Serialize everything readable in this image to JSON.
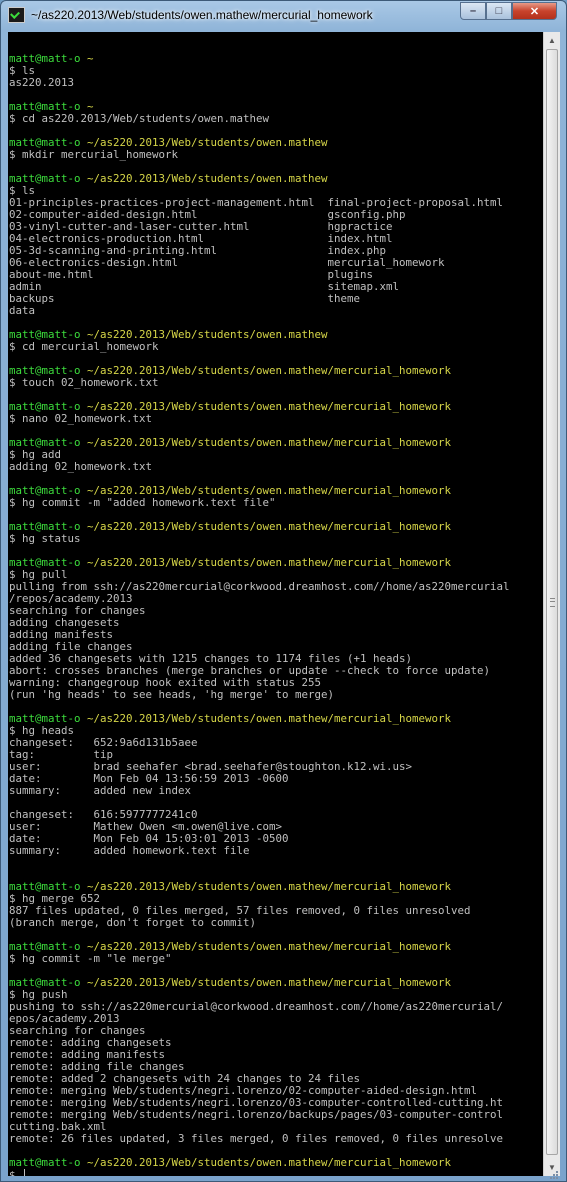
{
  "window": {
    "title": "~/as220.2013/Web/students/owen.mathew/mercurial_homework",
    "minimize_glyph": "–",
    "maximize_glyph": "□",
    "close_glyph": "✕"
  },
  "scrollbar": {
    "up_glyph": "▲",
    "down_glyph": "▼"
  },
  "terminal": {
    "lines": [
      {
        "t": "blank"
      },
      {
        "t": "prompt",
        "user": "matt@matt-o",
        "path": "~"
      },
      {
        "t": "out",
        "text": "$ ls"
      },
      {
        "t": "out",
        "text": "as220.2013"
      },
      {
        "t": "blank"
      },
      {
        "t": "prompt",
        "user": "matt@matt-o",
        "path": "~"
      },
      {
        "t": "out",
        "text": "$ cd as220.2013/Web/students/owen.mathew"
      },
      {
        "t": "blank"
      },
      {
        "t": "prompt",
        "user": "matt@matt-o",
        "path": "~/as220.2013/Web/students/owen.mathew"
      },
      {
        "t": "out",
        "text": "$ mkdir mercurial_homework"
      },
      {
        "t": "blank"
      },
      {
        "t": "prompt",
        "user": "matt@matt-o",
        "path": "~/as220.2013/Web/students/owen.mathew"
      },
      {
        "t": "out",
        "text": "$ ls"
      },
      {
        "t": "out",
        "text": "01-principles-practices-project-management.html  final-project-proposal.html"
      },
      {
        "t": "out",
        "text": "02-computer-aided-design.html                    gsconfig.php"
      },
      {
        "t": "out",
        "text": "03-vinyl-cutter-and-laser-cutter.html            hgpractice"
      },
      {
        "t": "out",
        "text": "04-electronics-production.html                   index.html"
      },
      {
        "t": "out",
        "text": "05-3d-scanning-and-printing.html                 index.php"
      },
      {
        "t": "out",
        "text": "06-electronics-design.html                       mercurial_homework"
      },
      {
        "t": "out",
        "text": "about-me.html                                    plugins"
      },
      {
        "t": "out",
        "text": "admin                                            sitemap.xml"
      },
      {
        "t": "out",
        "text": "backups                                          theme"
      },
      {
        "t": "out",
        "text": "data"
      },
      {
        "t": "blank"
      },
      {
        "t": "prompt",
        "user": "matt@matt-o",
        "path": "~/as220.2013/Web/students/owen.mathew"
      },
      {
        "t": "out",
        "text": "$ cd mercurial_homework"
      },
      {
        "t": "blank"
      },
      {
        "t": "prompt",
        "user": "matt@matt-o",
        "path": "~/as220.2013/Web/students/owen.mathew/mercurial_homework"
      },
      {
        "t": "out",
        "text": "$ touch 02_homework.txt"
      },
      {
        "t": "blank"
      },
      {
        "t": "prompt",
        "user": "matt@matt-o",
        "path": "~/as220.2013/Web/students/owen.mathew/mercurial_homework"
      },
      {
        "t": "out",
        "text": "$ nano 02_homework.txt"
      },
      {
        "t": "blank"
      },
      {
        "t": "prompt",
        "user": "matt@matt-o",
        "path": "~/as220.2013/Web/students/owen.mathew/mercurial_homework"
      },
      {
        "t": "out",
        "text": "$ hg add"
      },
      {
        "t": "out",
        "text": "adding 02_homework.txt"
      },
      {
        "t": "blank"
      },
      {
        "t": "prompt",
        "user": "matt@matt-o",
        "path": "~/as220.2013/Web/students/owen.mathew/mercurial_homework"
      },
      {
        "t": "out",
        "text": "$ hg commit -m \"added homework.text file\""
      },
      {
        "t": "blank"
      },
      {
        "t": "prompt",
        "user": "matt@matt-o",
        "path": "~/as220.2013/Web/students/owen.mathew/mercurial_homework"
      },
      {
        "t": "out",
        "text": "$ hg status"
      },
      {
        "t": "blank"
      },
      {
        "t": "prompt",
        "user": "matt@matt-o",
        "path": "~/as220.2013/Web/students/owen.mathew/mercurial_homework"
      },
      {
        "t": "out",
        "text": "$ hg pull"
      },
      {
        "t": "out",
        "text": "pulling from ssh://as220mercurial@corkwood.dreamhost.com//home/as220mercurial"
      },
      {
        "t": "out",
        "text": "/repos/academy.2013"
      },
      {
        "t": "out",
        "text": "searching for changes"
      },
      {
        "t": "out",
        "text": "adding changesets"
      },
      {
        "t": "out",
        "text": "adding manifests"
      },
      {
        "t": "out",
        "text": "adding file changes"
      },
      {
        "t": "out",
        "text": "added 36 changesets with 1215 changes to 1174 files (+1 heads)"
      },
      {
        "t": "out",
        "text": "abort: crosses branches (merge branches or update --check to force update)"
      },
      {
        "t": "out",
        "text": "warning: changegroup hook exited with status 255"
      },
      {
        "t": "out",
        "text": "(run 'hg heads' to see heads, 'hg merge' to merge)"
      },
      {
        "t": "blank"
      },
      {
        "t": "prompt",
        "user": "matt@matt-o",
        "path": "~/as220.2013/Web/students/owen.mathew/mercurial_homework"
      },
      {
        "t": "out",
        "text": "$ hg heads"
      },
      {
        "t": "out",
        "text": "changeset:   652:9a6d131b5aee"
      },
      {
        "t": "out",
        "text": "tag:         tip"
      },
      {
        "t": "out",
        "text": "user:        brad seehafer <brad.seehafer@stoughton.k12.wi.us>"
      },
      {
        "t": "out",
        "text": "date:        Mon Feb 04 13:56:59 2013 -0600"
      },
      {
        "t": "out",
        "text": "summary:     added new index"
      },
      {
        "t": "blank"
      },
      {
        "t": "out",
        "text": "changeset:   616:5977777241c0"
      },
      {
        "t": "out",
        "text": "user:        Mathew Owen <m.owen@live.com>"
      },
      {
        "t": "out",
        "text": "date:        Mon Feb 04 15:03:01 2013 -0500"
      },
      {
        "t": "out",
        "text": "summary:     added homework.text file"
      },
      {
        "t": "blank"
      },
      {
        "t": "blank"
      },
      {
        "t": "prompt",
        "user": "matt@matt-o",
        "path": "~/as220.2013/Web/students/owen.mathew/mercurial_homework"
      },
      {
        "t": "out",
        "text": "$ hg merge 652"
      },
      {
        "t": "out",
        "text": "887 files updated, 0 files merged, 57 files removed, 0 files unresolved"
      },
      {
        "t": "out",
        "text": "(branch merge, don't forget to commit)"
      },
      {
        "t": "blank"
      },
      {
        "t": "prompt",
        "user": "matt@matt-o",
        "path": "~/as220.2013/Web/students/owen.mathew/mercurial_homework"
      },
      {
        "t": "out",
        "text": "$ hg commit -m \"le merge\""
      },
      {
        "t": "blank"
      },
      {
        "t": "prompt",
        "user": "matt@matt-o",
        "path": "~/as220.2013/Web/students/owen.mathew/mercurial_homework"
      },
      {
        "t": "out",
        "text": "$ hg push"
      },
      {
        "t": "out",
        "text": "pushing to ssh://as220mercurial@corkwood.dreamhost.com//home/as220mercurial/"
      },
      {
        "t": "out",
        "text": "epos/academy.2013"
      },
      {
        "t": "out",
        "text": "searching for changes"
      },
      {
        "t": "out",
        "text": "remote: adding changesets"
      },
      {
        "t": "out",
        "text": "remote: adding manifests"
      },
      {
        "t": "out",
        "text": "remote: adding file changes"
      },
      {
        "t": "out",
        "text": "remote: added 2 changesets with 24 changes to 24 files"
      },
      {
        "t": "out",
        "text": "remote: merging Web/students/negri.lorenzo/02-computer-aided-design.html"
      },
      {
        "t": "out",
        "text": "remote: merging Web/students/negri.lorenzo/03-computer-controlled-cutting.ht"
      },
      {
        "t": "out",
        "text": "remote: merging Web/students/negri.lorenzo/backups/pages/03-computer-control"
      },
      {
        "t": "out",
        "text": "cutting.bak.xml"
      },
      {
        "t": "out",
        "text": "remote: 26 files updated, 3 files merged, 0 files removed, 0 files unresolve"
      },
      {
        "t": "blank"
      },
      {
        "t": "prompt",
        "user": "matt@matt-o",
        "path": "~/as220.2013/Web/students/owen.mathew/mercurial_homework"
      },
      {
        "t": "cursor",
        "text": "$ "
      }
    ]
  }
}
